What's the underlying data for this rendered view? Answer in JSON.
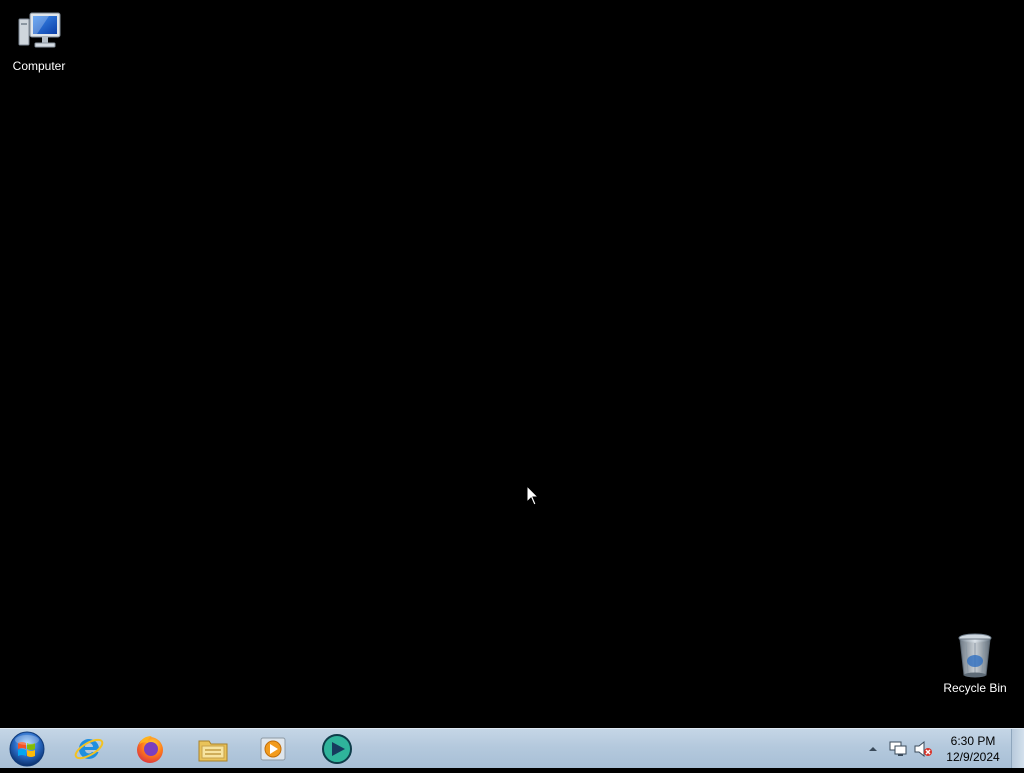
{
  "desktop": {
    "background_color": "#000000",
    "icons": [
      {
        "label": "Computer",
        "icon": "computer-icon"
      },
      {
        "label": "Recycle Bin",
        "icon": "recycle-bin-icon"
      }
    ]
  },
  "taskbar": {
    "start_icon": "windows-start-orb-icon",
    "pinned": [
      {
        "icon": "internet-explorer-icon"
      },
      {
        "icon": "firefox-icon"
      },
      {
        "icon": "file-explorer-folder-icon"
      },
      {
        "icon": "media-player-icon"
      },
      {
        "icon": "app-globe-icon"
      }
    ],
    "tray": {
      "icons": [
        "show-hidden-icons-arrow-icon",
        "network-icon",
        "volume-muted-icon"
      ],
      "time": "6:30 PM",
      "date": "12/9/2024"
    }
  }
}
